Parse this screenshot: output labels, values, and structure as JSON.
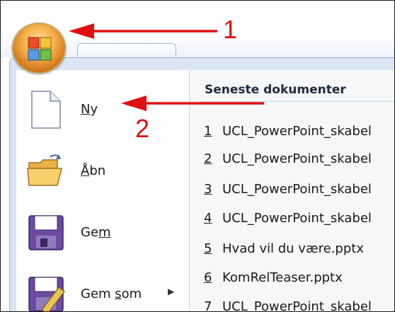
{
  "annotations": {
    "step1": "1",
    "step2": "2"
  },
  "menu": {
    "items": [
      {
        "pre": "",
        "key": "N",
        "post": "y"
      },
      {
        "pre": "",
        "key": "Å",
        "post": "bn"
      },
      {
        "pre": "Ge",
        "key": "m",
        "post": ""
      },
      {
        "pre": "Gem ",
        "key": "s",
        "post": "om"
      }
    ]
  },
  "recent": {
    "title": "Seneste dokumenter",
    "docs": [
      {
        "num": "1",
        "name": "UCL_PowerPoint_skabel"
      },
      {
        "num": "2",
        "name": "UCL_PowerPoint_skabel"
      },
      {
        "num": "3",
        "name": "UCL_PowerPoint_skabel"
      },
      {
        "num": "4",
        "name": "UCL_PowerPoint_skabel"
      },
      {
        "num": "5",
        "name": "Hvad vil du være.pptx"
      },
      {
        "num": "6",
        "name": "KomRelTeaser.pptx"
      },
      {
        "num": "7",
        "name": "UCL_PowerPoint_skabel"
      }
    ]
  },
  "colors": {
    "annotation": "#e01010",
    "office_orb": "#f6b04a"
  },
  "icons": [
    "office-button-icon",
    "new-document-icon",
    "open-folder-icon",
    "save-disk-icon",
    "save-as-icon"
  ]
}
